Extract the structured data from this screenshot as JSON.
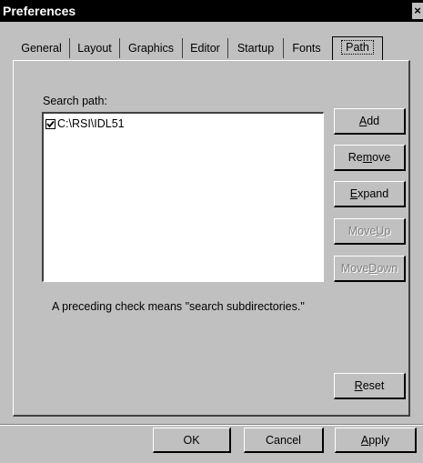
{
  "window": {
    "title": "Preferences",
    "close_glyph": "×"
  },
  "tabs": [
    {
      "label": "General"
    },
    {
      "label": "Layout"
    },
    {
      "label": "Graphics"
    },
    {
      "label": "Editor"
    },
    {
      "label": "Startup"
    },
    {
      "label": "Fonts"
    },
    {
      "label": "Path",
      "active": true
    }
  ],
  "path_panel": {
    "search_label": "Search path:",
    "entries": [
      {
        "path": "C:\\RSI\\IDL51",
        "checked": true
      }
    ],
    "hint": "A preceding check means \"search subdirectories.\""
  },
  "buttons": {
    "add": {
      "pre": "",
      "key": "A",
      "post": "dd"
    },
    "remove": {
      "pre": "Re",
      "key": "m",
      "post": "ove"
    },
    "expand": {
      "pre": "",
      "key": "E",
      "post": "xpand"
    },
    "move_up": {
      "pre": "Move ",
      "key": "U",
      "post": "p",
      "disabled": true
    },
    "move_down": {
      "pre": "Move ",
      "key": "D",
      "post": "own",
      "disabled": true
    },
    "reset": {
      "pre": "",
      "key": "R",
      "post": "eset"
    },
    "ok": "OK",
    "cancel": "Cancel",
    "apply": {
      "pre": "",
      "key": "A",
      "post": "pply"
    }
  }
}
